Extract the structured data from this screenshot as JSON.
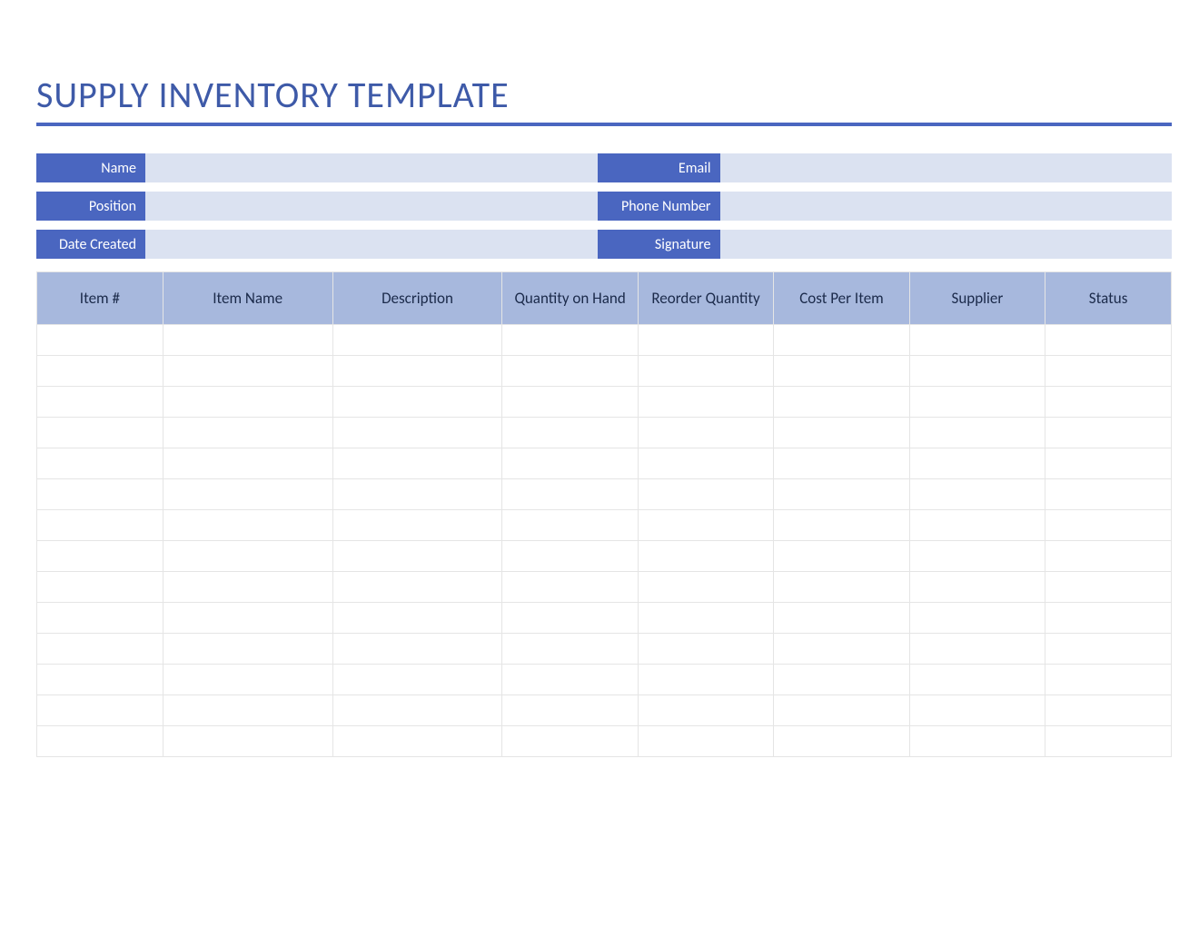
{
  "title": "SUPPLY INVENTORY TEMPLATE",
  "info": {
    "name": {
      "label": "Name",
      "value": ""
    },
    "email": {
      "label": "Email",
      "value": ""
    },
    "position": {
      "label": "Position",
      "value": ""
    },
    "phone": {
      "label": "Phone Number",
      "value": ""
    },
    "date_created": {
      "label": "Date Created",
      "value": ""
    },
    "signature": {
      "label": "Signature",
      "value": ""
    }
  },
  "table": {
    "headers": [
      "Item #",
      "Item Name",
      "Description",
      "Quantity on Hand",
      "Reorder Quantity",
      "Cost Per Item",
      "Supplier",
      "Status"
    ],
    "rows": [
      [
        "",
        "",
        "",
        "",
        "",
        "",
        "",
        ""
      ],
      [
        "",
        "",
        "",
        "",
        "",
        "",
        "",
        ""
      ],
      [
        "",
        "",
        "",
        "",
        "",
        "",
        "",
        ""
      ],
      [
        "",
        "",
        "",
        "",
        "",
        "",
        "",
        ""
      ],
      [
        "",
        "",
        "",
        "",
        "",
        "",
        "",
        ""
      ],
      [
        "",
        "",
        "",
        "",
        "",
        "",
        "",
        ""
      ],
      [
        "",
        "",
        "",
        "",
        "",
        "",
        "",
        ""
      ],
      [
        "",
        "",
        "",
        "",
        "",
        "",
        "",
        ""
      ],
      [
        "",
        "",
        "",
        "",
        "",
        "",
        "",
        ""
      ],
      [
        "",
        "",
        "",
        "",
        "",
        "",
        "",
        ""
      ],
      [
        "",
        "",
        "",
        "",
        "",
        "",
        "",
        ""
      ],
      [
        "",
        "",
        "",
        "",
        "",
        "",
        "",
        ""
      ],
      [
        "",
        "",
        "",
        "",
        "",
        "",
        "",
        ""
      ],
      [
        "",
        "",
        "",
        "",
        "",
        "",
        "",
        ""
      ]
    ]
  }
}
